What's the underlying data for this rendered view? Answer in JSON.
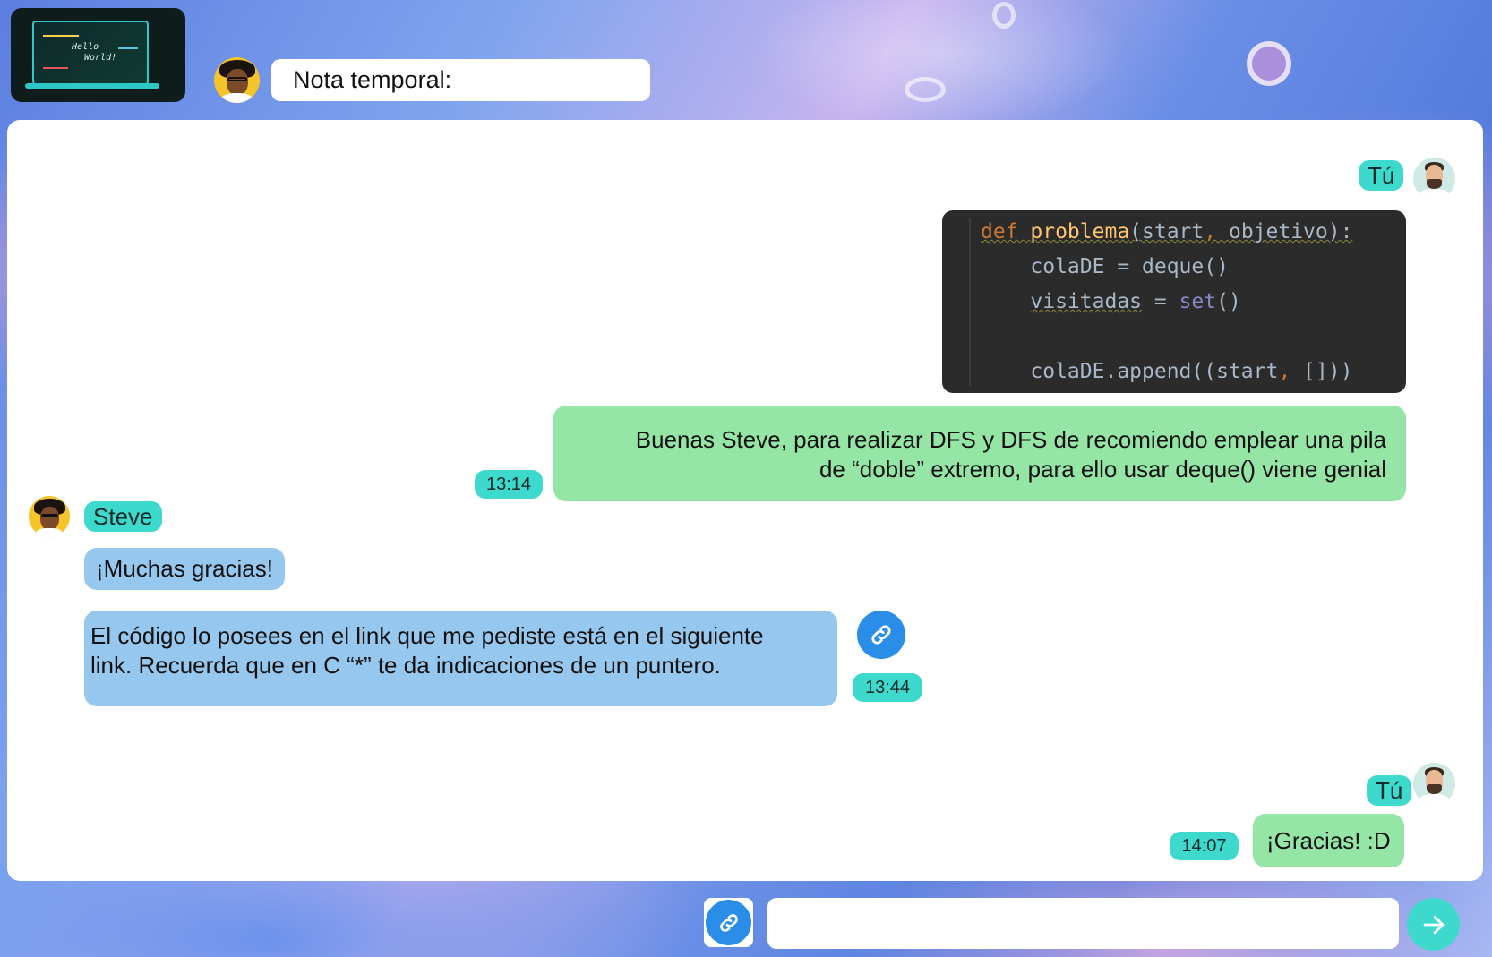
{
  "header": {
    "logo_text_line1": "Hello",
    "logo_text_line2": "World!",
    "note_label": "Nota temporal:"
  },
  "chat": {
    "messages": [
      {
        "sender": "Tú",
        "code": [
          "def problema(start, objetivo):",
          "    colaDE = deque()",
          "    visitadas = set()",
          "",
          "    colaDE.append((start, []))"
        ]
      },
      {
        "sender": "Tú",
        "text_line1": "Buenas Steve, para realizar DFS y DFS de recomiendo emplear una pila",
        "text_line2": "de “doble” extremo, para ello usar deque() viene genial",
        "time": "13:14"
      },
      {
        "sender": "Steve",
        "text": "¡Muchas gracias!"
      },
      {
        "sender": "Steve",
        "text_line1": "El código lo posees en el link que me pediste está en el siguiente",
        "text_line2": "link. Recuerda que en C “*” te da indicaciones de un puntero.",
        "time": "13:44",
        "icon": "link-icon"
      },
      {
        "sender": "Tú",
        "text": "¡Gracias! :D",
        "time": "14:07"
      }
    ]
  },
  "composer": {
    "input_value": "",
    "attach_icon": "link-icon",
    "send_icon": "arrow-right-icon"
  },
  "colors": {
    "accent": "#3dd9cc",
    "own_message": "#95e6a6",
    "other_message": "#96c8ef",
    "link_button": "#2a8ee8",
    "code_background": "#2b2b2b"
  }
}
